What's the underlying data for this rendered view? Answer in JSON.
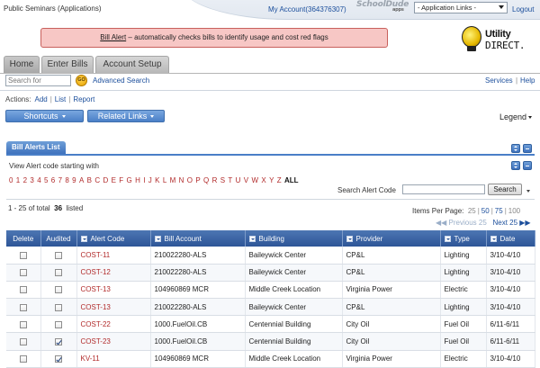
{
  "header": {
    "app_title": "Public Seminars (Applications)",
    "my_account": "My Account(364376307)",
    "schooldude_logo": "SchoolDude",
    "schooldude_apps": "apps",
    "app_links_selected": "- Application Links -",
    "logout": "Logout"
  },
  "alert_banner": {
    "link": "Bill Alert",
    "text": " – automatically checks bills to identify usage and cost red flags"
  },
  "logo": {
    "utility": "Utility",
    "direct": "DIRECT."
  },
  "tabs": [
    {
      "label": "Home"
    },
    {
      "label": "Enter Bills"
    },
    {
      "label": "Account Setup"
    }
  ],
  "search": {
    "placeholder": "Search for",
    "go": "GO",
    "advanced": "Advanced Search"
  },
  "top_links": {
    "services": "Services",
    "help": "Help",
    "sep": "|"
  },
  "actions": {
    "label": "Actions:",
    "add": "Add",
    "list": "List",
    "report": "Report",
    "sep": "|"
  },
  "toolbar": {
    "shortcuts": "Shortcuts",
    "related": "Related Links",
    "legend": "Legend"
  },
  "panel": {
    "title": "Bill Alerts List",
    "view_label": "View Alert code starting with",
    "letters": [
      "0",
      "1",
      "2",
      "3",
      "4",
      "5",
      "6",
      "7",
      "8",
      "9",
      "A",
      "B",
      "C",
      "D",
      "E",
      "F",
      "G",
      "H",
      "I",
      "J",
      "K",
      "L",
      "M",
      "N",
      "O",
      "P",
      "Q",
      "R",
      "S",
      "T",
      "U",
      "V",
      "W",
      "X",
      "Y",
      "Z"
    ],
    "all_label": "ALL",
    "search_code_label": "Search Alert Code",
    "search_button": "Search"
  },
  "pagination": {
    "range": "1 - 25 of total",
    "total": "36",
    "listed": "listed",
    "items_per_page_label": "Items Per Page:",
    "ipp": [
      "25",
      "50",
      "75",
      "100"
    ],
    "sep": "|",
    "previous": "Previous 25",
    "next": "Next 25"
  },
  "table": {
    "columns": [
      "Delete",
      "Audited",
      "Alert Code",
      "Bill Account",
      "Building",
      "Provider",
      "Type",
      "Date"
    ],
    "rows": [
      {
        "audited": false,
        "code": "COST-11",
        "account": "210022280-ALS",
        "building": "Baileywick Center",
        "provider": "CP&L",
        "type": "Lighting",
        "date": "3/10-4/10"
      },
      {
        "audited": false,
        "code": "COST-12",
        "account": "210022280-ALS",
        "building": "Baileywick Center",
        "provider": "CP&L",
        "type": "Lighting",
        "date": "3/10-4/10"
      },
      {
        "audited": false,
        "code": "COST-13",
        "account": "104960869 MCR",
        "building": "Middle Creek Location",
        "provider": "Virginia Power",
        "type": "Electric",
        "date": "3/10-4/10"
      },
      {
        "audited": false,
        "code": "COST-13",
        "account": "210022280-ALS",
        "building": "Baileywick Center",
        "provider": "CP&L",
        "type": "Lighting",
        "date": "3/10-4/10"
      },
      {
        "audited": false,
        "code": "COST-22",
        "account": "1000.FuelOil.CB",
        "building": "Centennial Building",
        "provider": "City Oil",
        "type": "Fuel Oil",
        "date": "6/11-6/11"
      },
      {
        "audited": true,
        "code": "COST-23",
        "account": "1000.FuelOil.CB",
        "building": "Centennial Building",
        "provider": "City Oil",
        "type": "Fuel Oil",
        "date": "6/11-6/11"
      },
      {
        "audited": true,
        "code": "KV-11",
        "account": "104960869 MCR",
        "building": "Middle Creek Location",
        "provider": "Virginia Power",
        "type": "Electric",
        "date": "3/10-4/10"
      }
    ]
  }
}
